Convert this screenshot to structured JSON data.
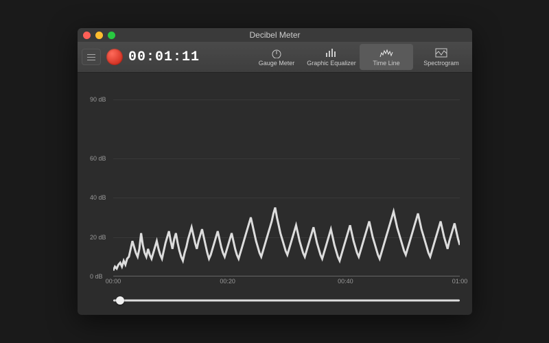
{
  "window": {
    "title": "Decibel Meter"
  },
  "toolbar": {
    "timer": "00:01:11",
    "modes": [
      {
        "id": "gauge",
        "label": "Gauge Meter",
        "active": false
      },
      {
        "id": "eq",
        "label": "Graphic Equalizer",
        "active": false
      },
      {
        "id": "timeline",
        "label": "Time Line",
        "active": true
      },
      {
        "id": "spectro",
        "label": "Spectrogram",
        "active": false
      }
    ]
  },
  "scrubber": {
    "position_pct": 2
  },
  "chart_data": {
    "type": "line",
    "title": "",
    "xlabel": "",
    "ylabel": "",
    "ylim": [
      0,
      100
    ],
    "y_ticks": [
      {
        "value": 0,
        "label": "0 dB"
      },
      {
        "value": 20,
        "label": "20 dB"
      },
      {
        "value": 40,
        "label": "40 dB"
      },
      {
        "value": 60,
        "label": "60 dB"
      },
      {
        "value": 90,
        "label": "90 dB"
      }
    ],
    "x_ticks": [
      {
        "pos": 0.0,
        "label": "00:00"
      },
      {
        "pos": 0.33,
        "label": "00:20"
      },
      {
        "pos": 0.67,
        "label": "00:40"
      },
      {
        "pos": 1.0,
        "label": "01:00"
      }
    ],
    "x": [
      0,
      1,
      2,
      3,
      4,
      5,
      6,
      7,
      8,
      9,
      10,
      11,
      12,
      13,
      14,
      15,
      16,
      17,
      18,
      19,
      20,
      21,
      22,
      23,
      24,
      25,
      26,
      27,
      28,
      29,
      30,
      31,
      32,
      33,
      34,
      35,
      36,
      37,
      38,
      39,
      40,
      41,
      42,
      43,
      44,
      45,
      46,
      47,
      48,
      49,
      50,
      51,
      52,
      53,
      54,
      55,
      56,
      57,
      58,
      59,
      60,
      61,
      62,
      63,
      64,
      65,
      66,
      67,
      68,
      69,
      70,
      71,
      72,
      73,
      74,
      75,
      76,
      77,
      78,
      79,
      80,
      81,
      82,
      83,
      84,
      85,
      86,
      87,
      88,
      89,
      90,
      91,
      92,
      93,
      94,
      95,
      96,
      97,
      98,
      99,
      100,
      101,
      102,
      103,
      104,
      105,
      106,
      107,
      108,
      109,
      110,
      111,
      112,
      113,
      114,
      115,
      116,
      117,
      118,
      119,
      120,
      121,
      122,
      123,
      124,
      125,
      126,
      127,
      128,
      129,
      130,
      131,
      132,
      133,
      134,
      135,
      136,
      137,
      138,
      139,
      140,
      141,
      142,
      143,
      144,
      145,
      146,
      147,
      148,
      149,
      150,
      151,
      152,
      153,
      154,
      155,
      156,
      157,
      158,
      159,
      160,
      161,
      162,
      163,
      164,
      165,
      166,
      167,
      168,
      169,
      170,
      171,
      172,
      173,
      174,
      175,
      176,
      177,
      178,
      179,
      180,
      181,
      182,
      183,
      184,
      185,
      186,
      187,
      188,
      189,
      190,
      191,
      192,
      193,
      194,
      195,
      196,
      197,
      198,
      199
    ],
    "values": [
      3,
      5,
      4,
      6,
      7,
      5,
      8,
      6,
      9,
      10,
      14,
      18,
      15,
      12,
      10,
      14,
      22,
      16,
      12,
      10,
      14,
      11,
      9,
      12,
      15,
      18,
      14,
      11,
      9,
      13,
      17,
      20,
      23,
      18,
      14,
      19,
      22,
      17,
      13,
      10,
      8,
      12,
      15,
      19,
      22,
      25,
      21,
      17,
      14,
      18,
      21,
      24,
      20,
      16,
      12,
      9,
      11,
      14,
      17,
      20,
      23,
      19,
      15,
      12,
      10,
      13,
      16,
      19,
      22,
      18,
      14,
      11,
      9,
      12,
      15,
      18,
      21,
      24,
      27,
      30,
      26,
      22,
      18,
      15,
      12,
      10,
      13,
      16,
      19,
      22,
      25,
      28,
      32,
      35,
      30,
      26,
      22,
      19,
      16,
      13,
      11,
      14,
      17,
      20,
      23,
      26,
      22,
      18,
      15,
      12,
      10,
      13,
      16,
      19,
      22,
      25,
      21,
      17,
      14,
      11,
      9,
      12,
      15,
      18,
      21,
      24,
      20,
      16,
      13,
      10,
      8,
      11,
      14,
      17,
      20,
      23,
      26,
      22,
      18,
      15,
      12,
      10,
      13,
      16,
      19,
      22,
      25,
      28,
      24,
      20,
      17,
      14,
      11,
      9,
      12,
      15,
      18,
      21,
      24,
      27,
      30,
      33,
      29,
      25,
      22,
      19,
      16,
      13,
      11,
      14,
      17,
      20,
      23,
      26,
      29,
      32,
      28,
      24,
      21,
      18,
      15,
      12,
      10,
      13,
      16,
      19,
      22,
      25,
      28,
      24,
      20,
      17,
      14,
      18,
      21,
      24,
      27,
      23,
      19,
      16
    ]
  }
}
